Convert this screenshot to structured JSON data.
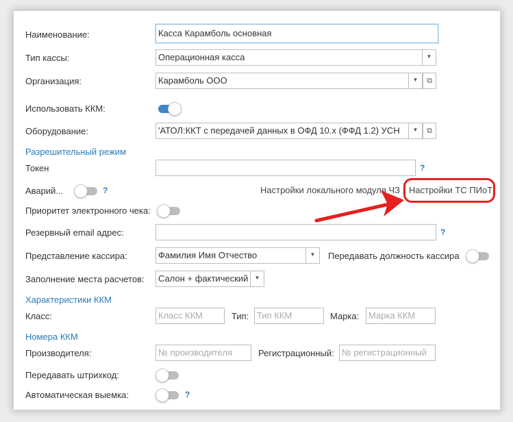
{
  "form": {
    "name": {
      "label": "Наименование:",
      "value": "Касса Карамболь основная"
    },
    "cash_type": {
      "label": "Тип кассы:",
      "value": "Операционная касса"
    },
    "organization": {
      "label": "Организация:",
      "value": "Карамболь ООО"
    },
    "use_kkm": {
      "label": "Использовать ККМ:",
      "on": true
    },
    "equipment": {
      "label": "Оборудование:",
      "value": "'АТОЛ:ККТ с передачей данных в ОФД 10.x (ФФД 1.2) УСН"
    },
    "permit_section": "Разрешительный режим",
    "token": {
      "label": "Токен",
      "value": ""
    },
    "emergency": {
      "label": "Аварий...",
      "on": false
    },
    "local_module_link": "Настройки локального модуля ЧЗ",
    "ts_piot_link": "Настройки ТС ПИоТ",
    "priority_echeck": {
      "label": "Приоритет электронного чека:",
      "on": false
    },
    "reserve_email": {
      "label": "Резервный email адрес:",
      "value": ""
    },
    "cashier_view": {
      "label": "Представление кассира:",
      "value": "Фамилия Имя Отчество"
    },
    "pass_position": {
      "label": "Передавать должность кассира",
      "on": false
    },
    "settlement_place": {
      "label": "Заполнение места расчетов:",
      "value": "Салон + фактический"
    },
    "kkm_section": "Характеристики ККМ",
    "class": {
      "label": "Класс:",
      "placeholder": "Класс ККМ"
    },
    "type": {
      "label": "Тип:",
      "placeholder": "Тип ККМ"
    },
    "brand": {
      "label": "Марка:",
      "placeholder": "Марка ККМ"
    },
    "numbers_section": "Номера ККМ",
    "manufacturer": {
      "label": "Производителя:",
      "placeholder": "№ производителя"
    },
    "registration": {
      "label": "Регистрационный:",
      "placeholder": "№ регистрационный"
    },
    "pass_barcode": {
      "label": "Передавать штрихкод:",
      "on": false
    },
    "auto_withdrawal": {
      "label": "Автоматическая выемка:",
      "on": false
    },
    "help_glyph": "?"
  },
  "colors": {
    "accent": "#2a7ab8",
    "annotation": "#e5201f",
    "toggle_on": "#3d87cc"
  }
}
